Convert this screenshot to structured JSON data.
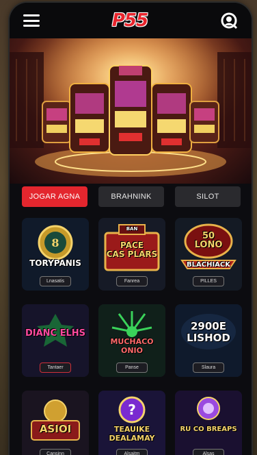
{
  "header": {
    "logo_text": "P55",
    "menu_icon": "hamburger-menu-icon",
    "user_icon": "user-icon"
  },
  "hero": {
    "image": "slot-machines-casino-banner"
  },
  "tabs": [
    {
      "label": "JOGAR AGNA",
      "active": true
    },
    {
      "label": "BRAHNINK",
      "active": false
    },
    {
      "label": "SILOT",
      "active": false
    }
  ],
  "games": [
    {
      "title": "TORYPANIS",
      "button": "Lnasatis",
      "top_text": "",
      "theme": "gold"
    },
    {
      "title": "PACE\nCAS PLARS",
      "button": "Fanrea",
      "top_text": "BAN",
      "theme": "red"
    },
    {
      "title": "BLACHIACK",
      "button": "PILLES",
      "top_text": "50\nLONO",
      "theme": "blackjack"
    },
    {
      "title": "DIANC ELHS",
      "button": "Tantaer",
      "top_text": "",
      "theme": "magenta"
    },
    {
      "title": "MUCHACO\nONIO",
      "button": "Panse",
      "top_text": "",
      "theme": "green"
    },
    {
      "title": "2900E\nLISHOD",
      "button": "Slaura",
      "top_text": "",
      "theme": "blue"
    },
    {
      "title": "ASIOI",
      "button": "Cansinn",
      "top_text": "",
      "theme": "asian"
    },
    {
      "title": "TEAUIKE\nDEALAMAY",
      "button": "Alsaitm",
      "top_text": "",
      "theme": "purple"
    },
    {
      "title": "RU CO BREAPS",
      "button": "Alsas",
      "top_text": "",
      "theme": "violet"
    }
  ],
  "colors": {
    "accent": "#e3262e",
    "background": "#0c0c10",
    "tab_inactive": "#2a2a2e",
    "card_bg": "#121826"
  }
}
